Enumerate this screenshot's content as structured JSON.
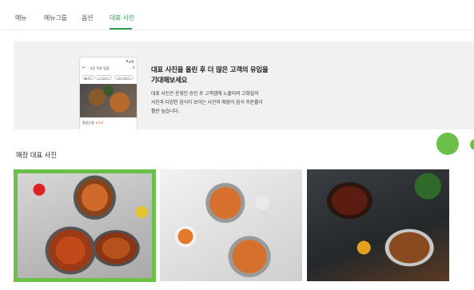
{
  "tabs": [
    {
      "label": "메뉴",
      "active": false
    },
    {
      "label": "메뉴그룹",
      "active": false
    },
    {
      "label": "옵션",
      "active": false
    },
    {
      "label": "대표 사진",
      "active": true
    }
  ],
  "banner": {
    "title": "대표 사진을 올린 후 더 많은 고객의 유입을 기대해보세요",
    "description": "대표 사진은 운영진 승인 후 고객앱에 노출되며 고화질의 사진과 다양한 음식이 보이는 사진의 매장이 음식 주문률이 훨씬 높습니다.",
    "phone": {
      "status": "▼◢ ▮",
      "back": "←",
      "title": "극은 주문 맛집",
      "search": "⌕",
      "chips": [
        "● 먹기",
        "◎ 마감하기",
        "지금 주문하기"
      ],
      "shop_name": "맛있는집",
      "shop_badge": "★4.8"
    }
  },
  "section_title": "매장 대표 사진",
  "photos": [
    {
      "name": "food-photo-1",
      "selected": true
    },
    {
      "name": "food-photo-2",
      "selected": false
    },
    {
      "name": "food-photo-3",
      "selected": false
    }
  ],
  "colors": {
    "accent": "#2e9e55",
    "selection": "#6cc04a",
    "banner_bg": "#f1f1f1"
  }
}
